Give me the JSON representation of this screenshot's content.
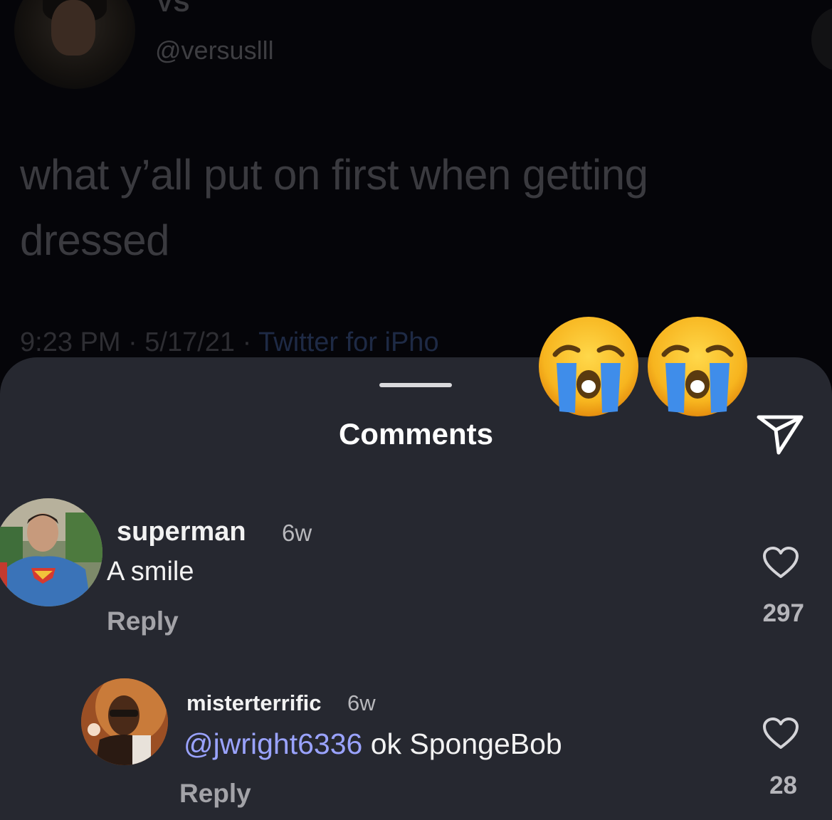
{
  "tweet": {
    "display_name": "VS",
    "handle": "@versuslll",
    "text": "what y’all put on first when getting dressed",
    "meta_time": "9:23 PM · 5/17/21 · ",
    "meta_source": "Twitter for iPho"
  },
  "comments_sheet": {
    "title": "Comments",
    "send_icon": "send-icon",
    "comments": [
      {
        "username": "superman",
        "time": "6w",
        "text": "A smile",
        "reply_label": "Reply",
        "likes": "297"
      },
      {
        "username": "misterterrific",
        "time": "6w",
        "mention": "@jwright6336",
        "text": " ok SpongeBob",
        "reply_label": "Reply",
        "likes": "28"
      }
    ]
  },
  "overlay_emojis": [
    "loudly-crying-face",
    "loudly-crying-face"
  ],
  "colors": {
    "sheet_background": "#262830",
    "mention": "#9aa3ff",
    "tweet_text": "#3a3a3f"
  }
}
